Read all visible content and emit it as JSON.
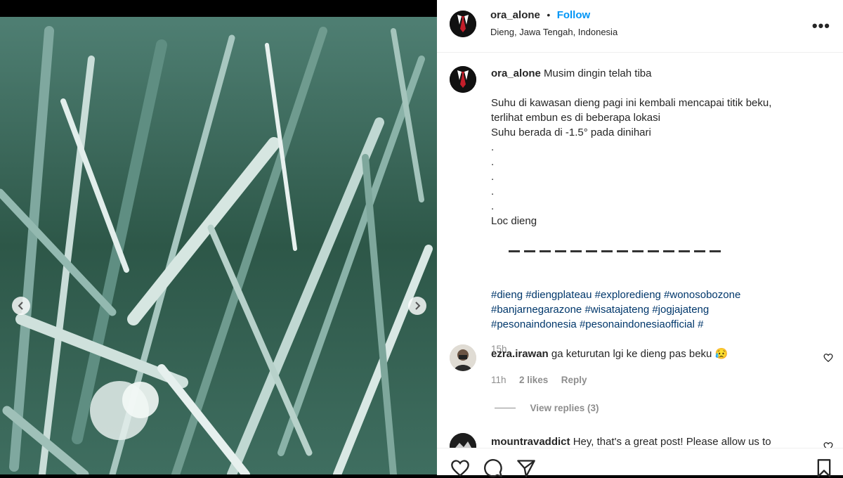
{
  "post": {
    "username": "ora_alone",
    "follow_label": "Follow",
    "location": "Dieng, Jawa Tengah, Indonesia",
    "more_icon": "•••",
    "caption_first": "Musim dingin telah tiba",
    "caption_lines": [
      "Suhu di kawasan dieng pagi ini kembali mencapai titik beku,",
      "terlihat embun es di beberapa lokasi",
      "Suhu berada di -1.5° pada dinihari"
    ],
    "dots": [
      ".",
      ".",
      ".",
      ".",
      "."
    ],
    "loc": "Loc dieng",
    "hashtags_lines": [
      "#dieng #diengplateau #exploredieng #wonosobozone",
      "#banjarnegarazone #wisatajateng #jogjajateng",
      "#pesonaindonesia #pesonaindonesiaofficial #"
    ],
    "time": "15h"
  },
  "comments": [
    {
      "username": "ezra.irawan",
      "text": "ga keturutan lgi ke dieng pas beku 😥",
      "time": "11h",
      "likes": "2 likes",
      "reply_label": "Reply",
      "view_replies": "View replies (3)"
    },
    {
      "username": "mountravaddict",
      "text": "Hey, that's a great post! Please allow us to"
    }
  ],
  "icons": {
    "like": "heart-icon",
    "comment": "comment-icon",
    "share": "share-icon",
    "save": "bookmark-icon",
    "prev": "chevron-left-icon",
    "next": "chevron-right-icon"
  },
  "colors": {
    "follow": "#0095f6",
    "hashtag": "#00376b",
    "muted": "#8e8e8e"
  }
}
